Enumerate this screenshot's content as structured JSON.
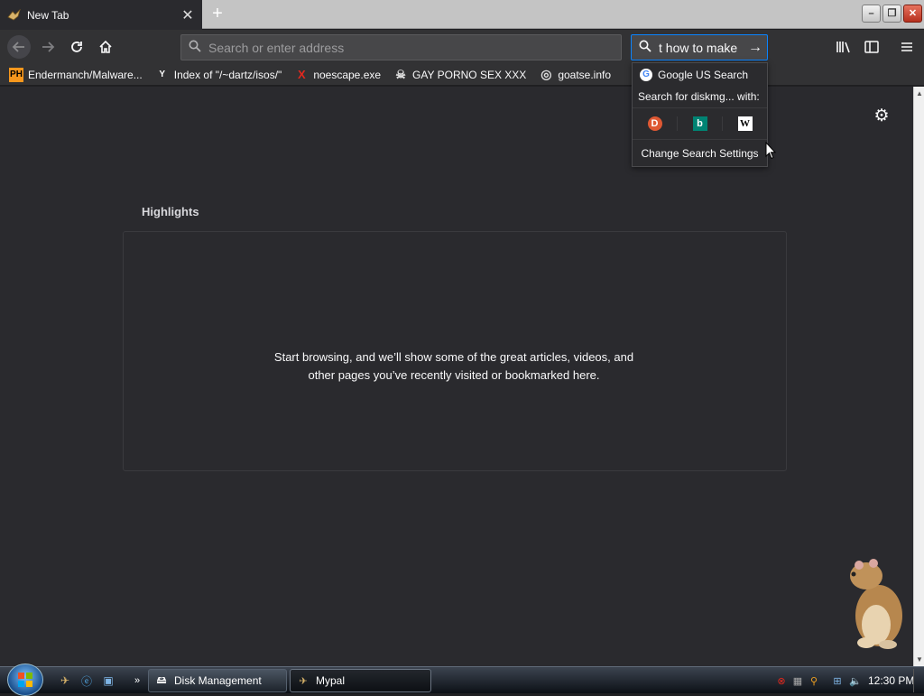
{
  "tab": {
    "title": "New Tab"
  },
  "window_controls": {
    "minimize": "–",
    "maximize": "❐",
    "close": "✕"
  },
  "url_bar": {
    "placeholder": "Search or enter address"
  },
  "search_bar": {
    "value": "t how to make"
  },
  "bookmarks": [
    {
      "label": "Endermanch/Malware...",
      "icon": "PH",
      "icon_bg": "#f7971d",
      "icon_fg": "#000000"
    },
    {
      "label": "Index of \"/~dartz/isos/\"",
      "icon": "Y",
      "icon_bg": "#323234",
      "icon_fg": "#ffffff"
    },
    {
      "label": "noescape.exe",
      "icon": "X",
      "icon_bg": "#323234",
      "icon_fg": "#e0281e"
    },
    {
      "label": "GAY PORNO SEX XXX",
      "icon": "☠",
      "icon_bg": "#323234",
      "icon_fg": "#dddddd"
    },
    {
      "label": "goatse.info",
      "icon": "◎",
      "icon_bg": "#323234",
      "icon_fg": "#dddddd"
    }
  ],
  "search_dropdown": {
    "default_engine": "Google US Search",
    "search_for": "Search for diskmg...  with:",
    "engines": [
      {
        "name": "duckduckgo-icon",
        "glyph": "D",
        "bg": "#de5833",
        "fg": "#ffffff"
      },
      {
        "name": "bing-icon",
        "glyph": "b",
        "bg": "#008373",
        "fg": "#ffffff"
      },
      {
        "name": "wikipedia-icon",
        "glyph": "W",
        "bg": "#ffffff",
        "fg": "#000000"
      }
    ],
    "change_settings": "Change Search Settings"
  },
  "highlights": {
    "title": "Highlights",
    "empty_message": "Start browsing, and we’ll show some of the great articles, videos, and other pages you’ve recently visited or bookmarked here."
  },
  "taskbar": {
    "tasks": [
      {
        "label": "Disk Management"
      },
      {
        "label": "Mypal"
      }
    ],
    "clock": "12:30 PM"
  },
  "colors": {
    "accent": "#0a84ff",
    "content_bg": "#2a2a2e",
    "toolbar_bg": "#323234"
  }
}
